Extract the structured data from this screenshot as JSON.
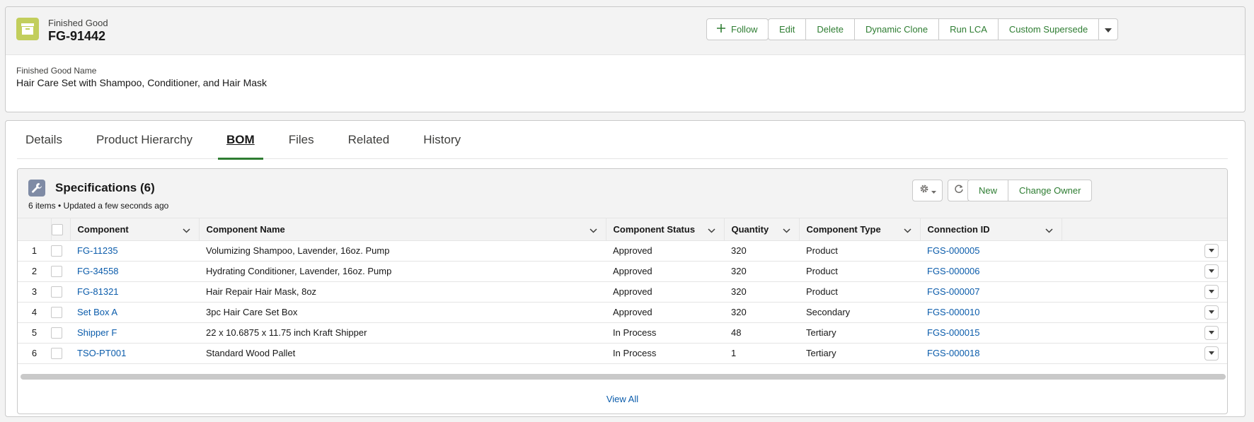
{
  "record": {
    "object_type": "Finished Good",
    "title": "FG-91442",
    "field_label": "Finished Good Name",
    "field_value": "Hair Care Set with Shampoo, Conditioner, and Hair Mask"
  },
  "actions": {
    "follow": "Follow",
    "buttons": [
      "Edit",
      "Delete",
      "Dynamic Clone",
      "Run LCA",
      "Custom Supersede"
    ]
  },
  "tabs": [
    {
      "label": "Details",
      "active": false
    },
    {
      "label": "Product Hierarchy",
      "active": false
    },
    {
      "label": "BOM",
      "active": true
    },
    {
      "label": "Files",
      "active": false
    },
    {
      "label": "Related",
      "active": false
    },
    {
      "label": "History",
      "active": false
    }
  ],
  "related_list": {
    "title": "Specifications (6)",
    "meta": "6 items • Updated a few seconds ago",
    "new_label": "New",
    "change_owner_label": "Change Owner",
    "columns": [
      "Component",
      "Component Name",
      "Component Status",
      "Quantity",
      "Component Type",
      "Connection ID"
    ],
    "rows": [
      {
        "n": "1",
        "component": "FG-11235",
        "name": "Volumizing Shampoo, Lavender, 16oz. Pump",
        "status": "Approved",
        "qty": "320",
        "type": "Product",
        "conn": "FGS-000005"
      },
      {
        "n": "2",
        "component": "FG-34558",
        "name": "Hydrating Conditioner, Lavender, 16oz. Pump",
        "status": "Approved",
        "qty": "320",
        "type": "Product",
        "conn": "FGS-000006"
      },
      {
        "n": "3",
        "component": "FG-81321",
        "name": "Hair Repair Hair Mask, 8oz",
        "status": "Approved",
        "qty": "320",
        "type": "Product",
        "conn": "FGS-000007"
      },
      {
        "n": "4",
        "component": "Set Box A",
        "name": "3pc Hair Care Set Box",
        "status": "Approved",
        "qty": "320",
        "type": "Secondary",
        "conn": "FGS-000010"
      },
      {
        "n": "5",
        "component": "Shipper F",
        "name": "22 x 10.6875 x 11.75 inch Kraft Shipper",
        "status": "In Process",
        "qty": "48",
        "type": "Tertiary",
        "conn": "FGS-000015"
      },
      {
        "n": "6",
        "component": "TSO-PT001",
        "name": "Standard Wood Pallet",
        "status": "In Process",
        "qty": "1",
        "type": "Tertiary",
        "conn": "FGS-000018"
      }
    ],
    "view_all": "View All"
  },
  "colors": {
    "accent_green": "#2e7d32",
    "link_blue": "#0b5cab",
    "record_icon": "#c2ce5c",
    "list_icon": "#7f8ba5"
  },
  "icons": {
    "record": "archive-box-icon",
    "list": "wrench-icon",
    "follow": "plus-icon",
    "settings": "gear-icon",
    "refresh": "refresh-icon"
  }
}
